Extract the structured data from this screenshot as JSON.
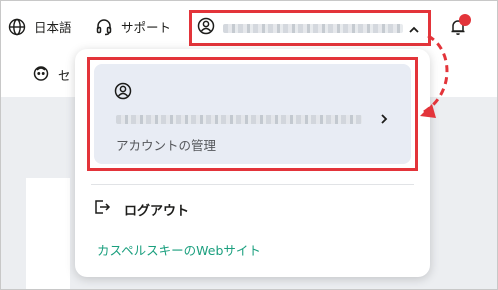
{
  "header": {
    "language_label": "日本語",
    "support_label": "サポート",
    "notification_dot_color": "#e3343a"
  },
  "secondary": {
    "partial_label": "セ"
  },
  "account_menu": {
    "card": {
      "link_label": "アカウントの管理"
    },
    "logout_label": "ログアウト",
    "website_link_label": "カスペルスキーのWebサイト"
  },
  "colors": {
    "highlight": "#e3343a",
    "link": "#1a9f7e",
    "card_bg": "#e8ecf4"
  }
}
